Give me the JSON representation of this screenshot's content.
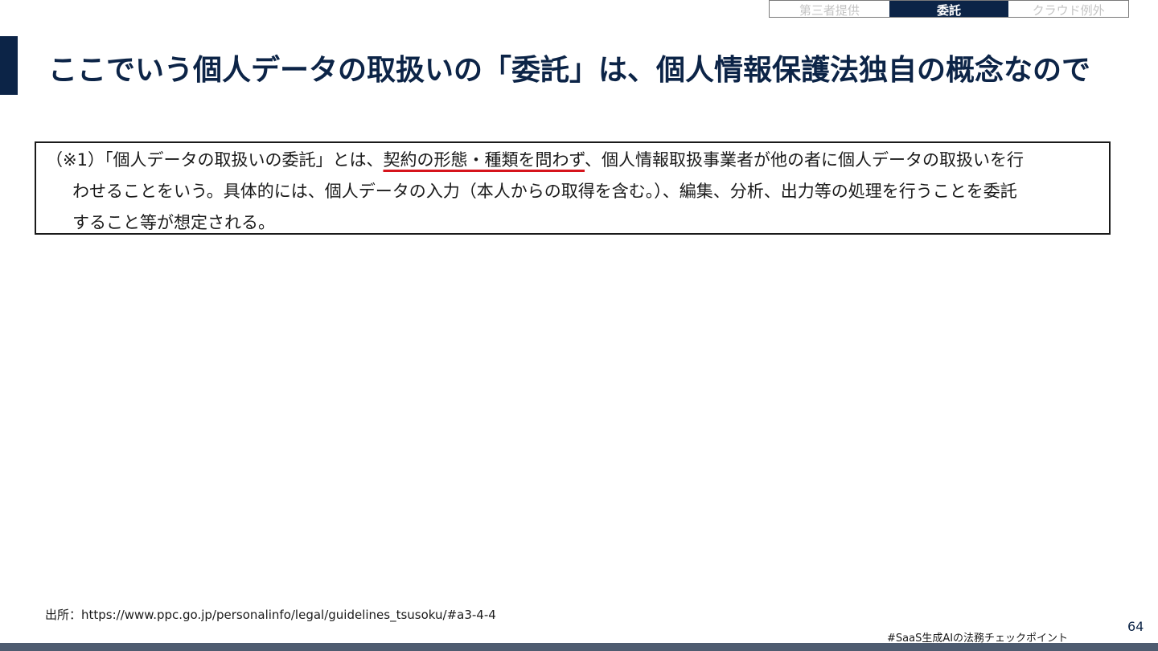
{
  "nav_tabs": [
    {
      "label": "第三者提供",
      "active": false
    },
    {
      "label": "委託",
      "active": true
    },
    {
      "label": "クラウド例外",
      "active": false
    }
  ],
  "title": "ここでいう個人データの取扱いの「委託」は、個人情報保護法独自の概念なので",
  "quote": {
    "line1_before": "（※1）「個人データの取扱いの委託」とは、",
    "line1_highlight": "契約の形態・種類を問わず",
    "line1_after": "、個人情報取扱事業者が他の者に個人データの取扱いを行",
    "line2": "わせることをいう。具体的には、個人データの入力（本人からの取得を含む。）、編集、分析、出力等の処理を行うことを委託",
    "line3": "すること等が想定される。"
  },
  "source": "出所：https://www.ppc.go.jp/personalinfo/legal/guidelines_tsusoku/#a3-4-4",
  "hashtag": "#SaaS生成AIの法務チェックポイント",
  "page_number": "64",
  "colors": {
    "navy": "#0c2447",
    "underline_red": "#d6141c",
    "footer": "#4e5c70"
  }
}
